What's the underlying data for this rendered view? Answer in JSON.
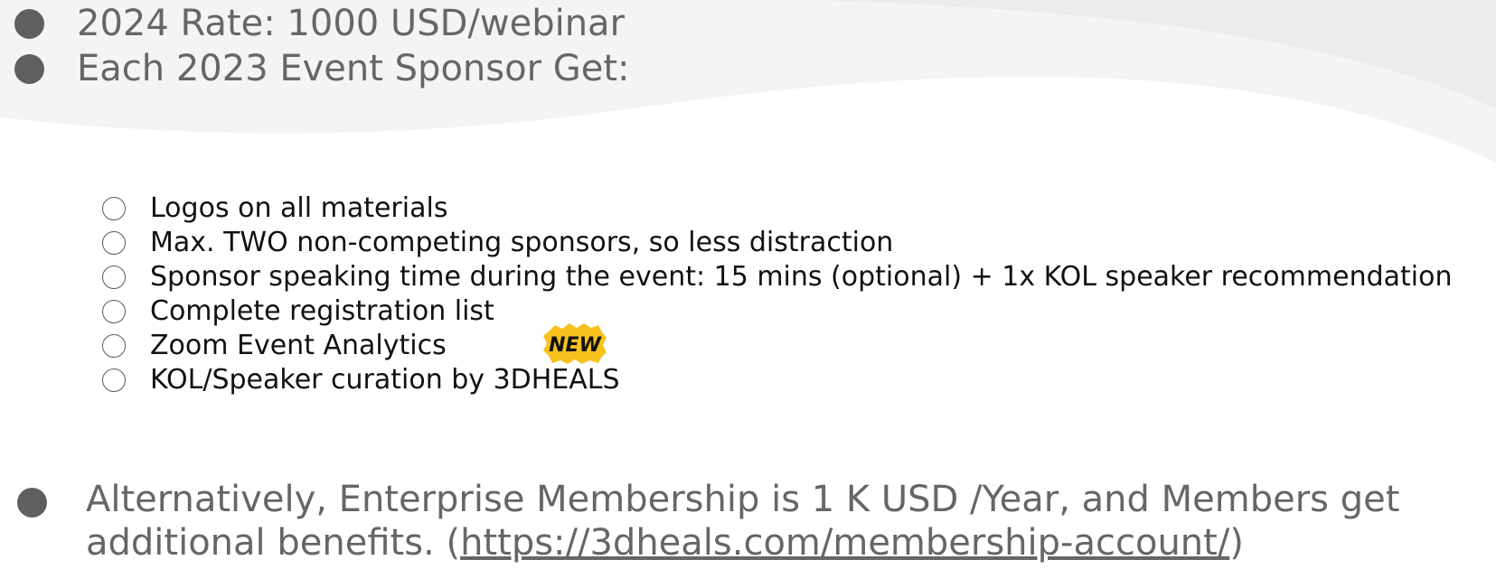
{
  "top_bullets": [
    {
      "text": "2024 Rate: 1000 USD/webinar"
    },
    {
      "text": "Each 2023 Event Sponsor Get:"
    }
  ],
  "benefits": [
    {
      "text": "Logos on all materials"
    },
    {
      "text": "Max. TWO non-competing sponsors, so less distraction"
    },
    {
      "text": "Sponsor speaking time during the event: 15 mins (optional) + 1x KOL speaker recommendation"
    },
    {
      "text": "Complete registration list"
    },
    {
      "text": "Zoom Event Analytics"
    },
    {
      "text": "KOL/Speaker curation by 3DHEALS"
    }
  ],
  "new_badge": {
    "text": "NEW",
    "color": "#f7c21e"
  },
  "membership": {
    "text": "Alternatively, Enterprise Membership is 1 K USD /Year, and Members get additional benefits. (",
    "link": "https://3dheals.com/membership-account/",
    "close": ")"
  },
  "colors": {
    "bullet": "#5f5f5f",
    "main_text": "#666666",
    "sub_text": "#111111",
    "swoosh": "#eeeeee"
  }
}
